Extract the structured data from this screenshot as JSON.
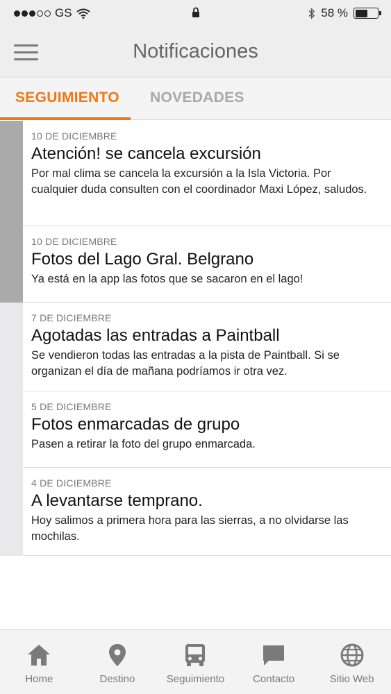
{
  "status_bar": {
    "carrier": "GS",
    "battery_percent": "58 %",
    "battery_level": 0.58
  },
  "header": {
    "title": "Notificaciones",
    "menu_icon": "hamburger-icon"
  },
  "tabs": [
    {
      "label": "SEGUIMIENTO",
      "active": true
    },
    {
      "label": "NOVEDADES",
      "active": false
    }
  ],
  "colors": {
    "accent": "#f07812",
    "header_bg": "#eeeeee",
    "rail": "#e9e9ec",
    "rail_highlight": "#aaaaaa"
  },
  "notifications": [
    {
      "date": "10 DE DICIEMBRE",
      "title": "Atención! se cancela excursión",
      "body": "Por mal clima se cancela la excursión a la Isla Victoria. Por cualquier duda consulten con el coordinador Maxi López, saludos."
    },
    {
      "date": "10 DE DICIEMBRE",
      "title": "Fotos del Lago Gral. Belgrano",
      "body": "Ya está en la app las fotos que se sacaron en el lago!"
    },
    {
      "date": "7 DE DICIEMBRE",
      "title": "Agotadas las entradas a Paintball",
      "body": "Se vendieron todas las entradas a la pista de Paintball. Si se organizan el día de mañana podríamos ir otra vez."
    },
    {
      "date": "5 DE DICIEMBRE",
      "title": "Fotos enmarcadas de grupo",
      "body": "Pasen a retirar la foto del grupo enmarcada."
    },
    {
      "date": "4 DE DICIEMBRE",
      "title": "A levantarse temprano.",
      "body": "Hoy salimos a primera hora para las sierras, a no olvidarse las mochilas."
    }
  ],
  "bottom_nav": [
    {
      "label": "Home",
      "icon": "home-icon"
    },
    {
      "label": "Destino",
      "icon": "location-pin-icon"
    },
    {
      "label": "Seguimiento",
      "icon": "bus-icon"
    },
    {
      "label": "Contacto",
      "icon": "chat-bubble-icon"
    },
    {
      "label": "Sitio Web",
      "icon": "globe-icon"
    }
  ]
}
